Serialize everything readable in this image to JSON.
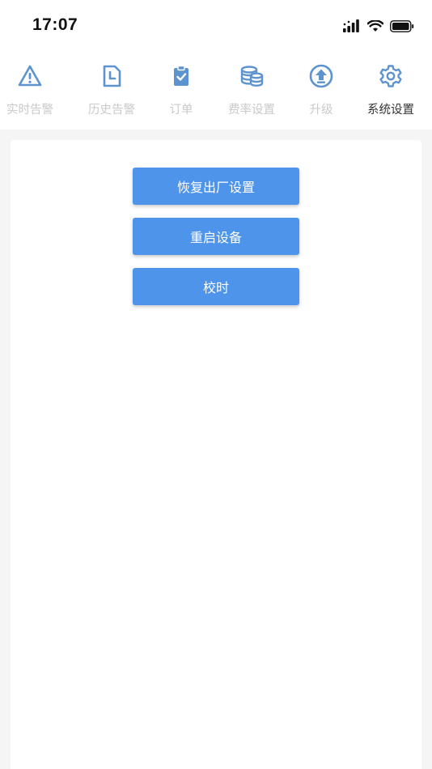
{
  "status_bar": {
    "time": "17:07"
  },
  "colors": {
    "accent": "#4d94ea",
    "icon_blue": "#5d93cf",
    "label_inactive": "#c9c9c9",
    "label_active": "#333333"
  },
  "nav": {
    "items": [
      {
        "label": "实时告警",
        "icon": "warning-triangle-icon",
        "active": false
      },
      {
        "label": "历史告警",
        "icon": "document-clock-icon",
        "active": false
      },
      {
        "label": "订单",
        "icon": "clipboard-check-icon",
        "active": false
      },
      {
        "label": "费率设置",
        "icon": "coin-stack-icon",
        "active": false
      },
      {
        "label": "升级",
        "icon": "upload-arrow-icon",
        "active": false
      },
      {
        "label": "系统设置",
        "icon": "gear-icon",
        "active": true
      }
    ]
  },
  "actions": {
    "factory_reset_label": "恢复出厂设置",
    "restart_label": "重启设备",
    "time_sync_label": "校时"
  }
}
